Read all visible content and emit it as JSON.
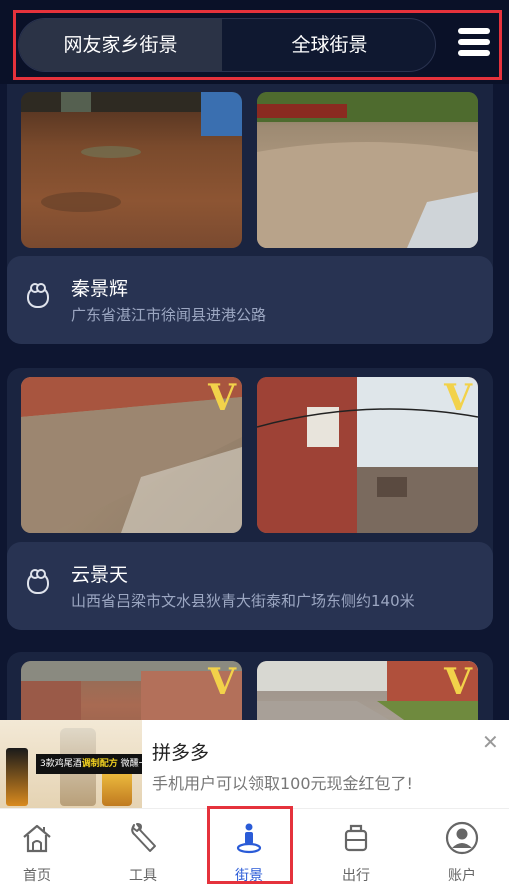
{
  "tabs": [
    {
      "label": "网友家乡街景",
      "active": true
    },
    {
      "label": "全球街景",
      "active": false
    }
  ],
  "menu_icon": "hamburger-menu-icon",
  "cards": [
    {
      "name": "秦景辉",
      "address": "广东省湛江市徐闻县进港公路",
      "vr_badges": [
        false,
        false
      ]
    },
    {
      "name": "云景天",
      "address": "山西省吕梁市文水县狄青大街泰和广场东侧约140米",
      "vr_badges": [
        true,
        true
      ]
    },
    {
      "vr_badges": [
        true,
        true
      ]
    }
  ],
  "vr_badge_text": "V",
  "ad": {
    "image_text_line1": "3款鸡尾酒",
    "image_text_highlight": "调制配方",
    "image_text_line2": "微醺一下~",
    "title": "拼多多",
    "description": "手机用户可以领取100元现金红包了!",
    "close_icon": "close-icon"
  },
  "nav": [
    {
      "label": "首页",
      "icon": "home-icon",
      "active": false
    },
    {
      "label": "工具",
      "icon": "wrench-icon",
      "active": false
    },
    {
      "label": "街景",
      "icon": "person-location-icon",
      "active": true
    },
    {
      "label": "出行",
      "icon": "luggage-icon",
      "active": false
    },
    {
      "label": "账户",
      "icon": "user-avatar-icon",
      "active": false
    }
  ],
  "colors": {
    "background": "#0e1631",
    "card": "#1a2440",
    "accent_active": "#2a5bd7",
    "highlight_frame": "#e5323c",
    "vr_badge": "#f2d24a"
  }
}
